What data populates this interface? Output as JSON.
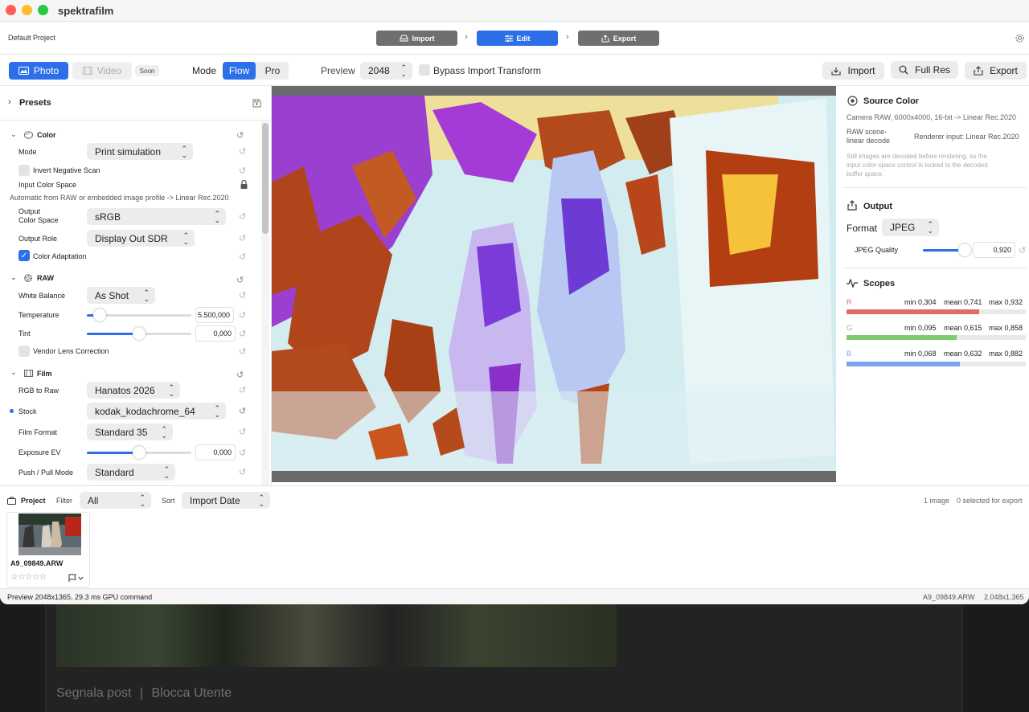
{
  "app_title": "spektrafilm",
  "project_name": "Default Project",
  "workflow_steps": [
    {
      "label": "Import",
      "active": false
    },
    {
      "label": "Edit",
      "active": true
    },
    {
      "label": "Export",
      "active": false
    }
  ],
  "media_tabs": {
    "photo": "Photo",
    "video": "Video",
    "soon_badge": "Soon"
  },
  "mode": {
    "label": "Mode",
    "options": [
      "Flow",
      "Pro"
    ],
    "selected": "Flow"
  },
  "preview": {
    "label": "Preview",
    "value": "2048"
  },
  "bypass": {
    "label": "Bypass Import Transform",
    "checked": false
  },
  "top_actions": {
    "import": "Import",
    "full_res": "Full Res",
    "export": "Export"
  },
  "presets": {
    "title": "Presets"
  },
  "color_section": {
    "title": "Color",
    "mode_label": "Mode",
    "mode_value": "Print simulation",
    "invert_label": "Invert Negative Scan",
    "invert_checked": false,
    "input_cs_label": "Input Color Space",
    "input_cs_note": "Automatic from RAW or embedded image profile -> Linear Rec.2020",
    "output_cs_label_1": "Output",
    "output_cs_label_2": "Color Space",
    "output_cs_value": "sRGB",
    "output_role_label": "Output Role",
    "output_role_value": "Display Out SDR",
    "adaptation_label": "Color Adaptation",
    "adaptation_checked": true
  },
  "raw_section": {
    "title": "RAW",
    "wb_label": "White Balance",
    "wb_value": "As Shot",
    "temp_label": "Temperature",
    "temp_value": "5.500,000",
    "temp_level": 0.12,
    "tint_label": "Tint",
    "tint_value": "0,000",
    "tint_level": 0.5,
    "lens_label": "Vendor Lens Correction",
    "lens_checked": false
  },
  "film_section": {
    "title": "Film",
    "rgb_label": "RGB to Raw",
    "rgb_value": "Hanatos 2026",
    "stock_label": "Stock",
    "stock_value": "kodak_kodachrome_64",
    "format_label": "Film Format",
    "format_value": "Standard 35",
    "ev_label": "Exposure EV",
    "ev_value": "0,000",
    "ev_level": 0.5,
    "push_label": "Push / Pull Mode",
    "push_value": "Standard"
  },
  "source_color": {
    "title": "Source Color",
    "info": "Camera RAW, 6000x4000, 16-bit -> Linear Rec.2020",
    "decode_label_1": "RAW scene-",
    "decode_label_2": "linear decode",
    "decode_value": "Renderer input: Linear Rec.2020",
    "note_1": "Still images are decoded before rendering, so the",
    "note_2": "input color-space control is locked to the decoded",
    "note_3": "buffer space."
  },
  "output": {
    "title": "Output",
    "format_label": "Format",
    "format_value": "JPEG",
    "quality_label": "JPEG Quality",
    "quality_value": "0,920",
    "quality_level": 0.92
  },
  "scopes": {
    "title": "Scopes",
    "channels": [
      {
        "name": "R",
        "min": "min 0,304",
        "mean": "mean 0,741",
        "max": "max 0,932",
        "color": "#e06c66",
        "level": 0.741
      },
      {
        "name": "G",
        "min": "min 0,095",
        "mean": "mean 0,615",
        "max": "max 0,858",
        "color": "#7ecb72",
        "level": 0.615
      },
      {
        "name": "B",
        "min": "min 0,068",
        "mean": "mean 0,632",
        "max": "max 0,882",
        "color": "#7aa2ee",
        "level": 0.632
      }
    ]
  },
  "project_bar": {
    "title": "Project",
    "filter_label": "Filter",
    "filter_value": "All",
    "sort_label": "Sort",
    "sort_value": "Import Date",
    "count": "1 image",
    "selected": "0 selected for export"
  },
  "thumbnail": {
    "filename": "A9_09849.ARW",
    "stars": "☆☆☆☆☆",
    "rating": 0
  },
  "status_bar": {
    "left": "Preview 2048x1365, 29.3 ms GPU command",
    "file": "A9_09849.ARW",
    "size": "2.048x1.365"
  },
  "background_page": {
    "report": "Segnala post",
    "separator": "|",
    "block": "Blocca Utente"
  },
  "colors": {
    "accent": "#2c6fe8",
    "step_inactive": "#6f6f6f",
    "panel_bg": "#ffffff"
  }
}
